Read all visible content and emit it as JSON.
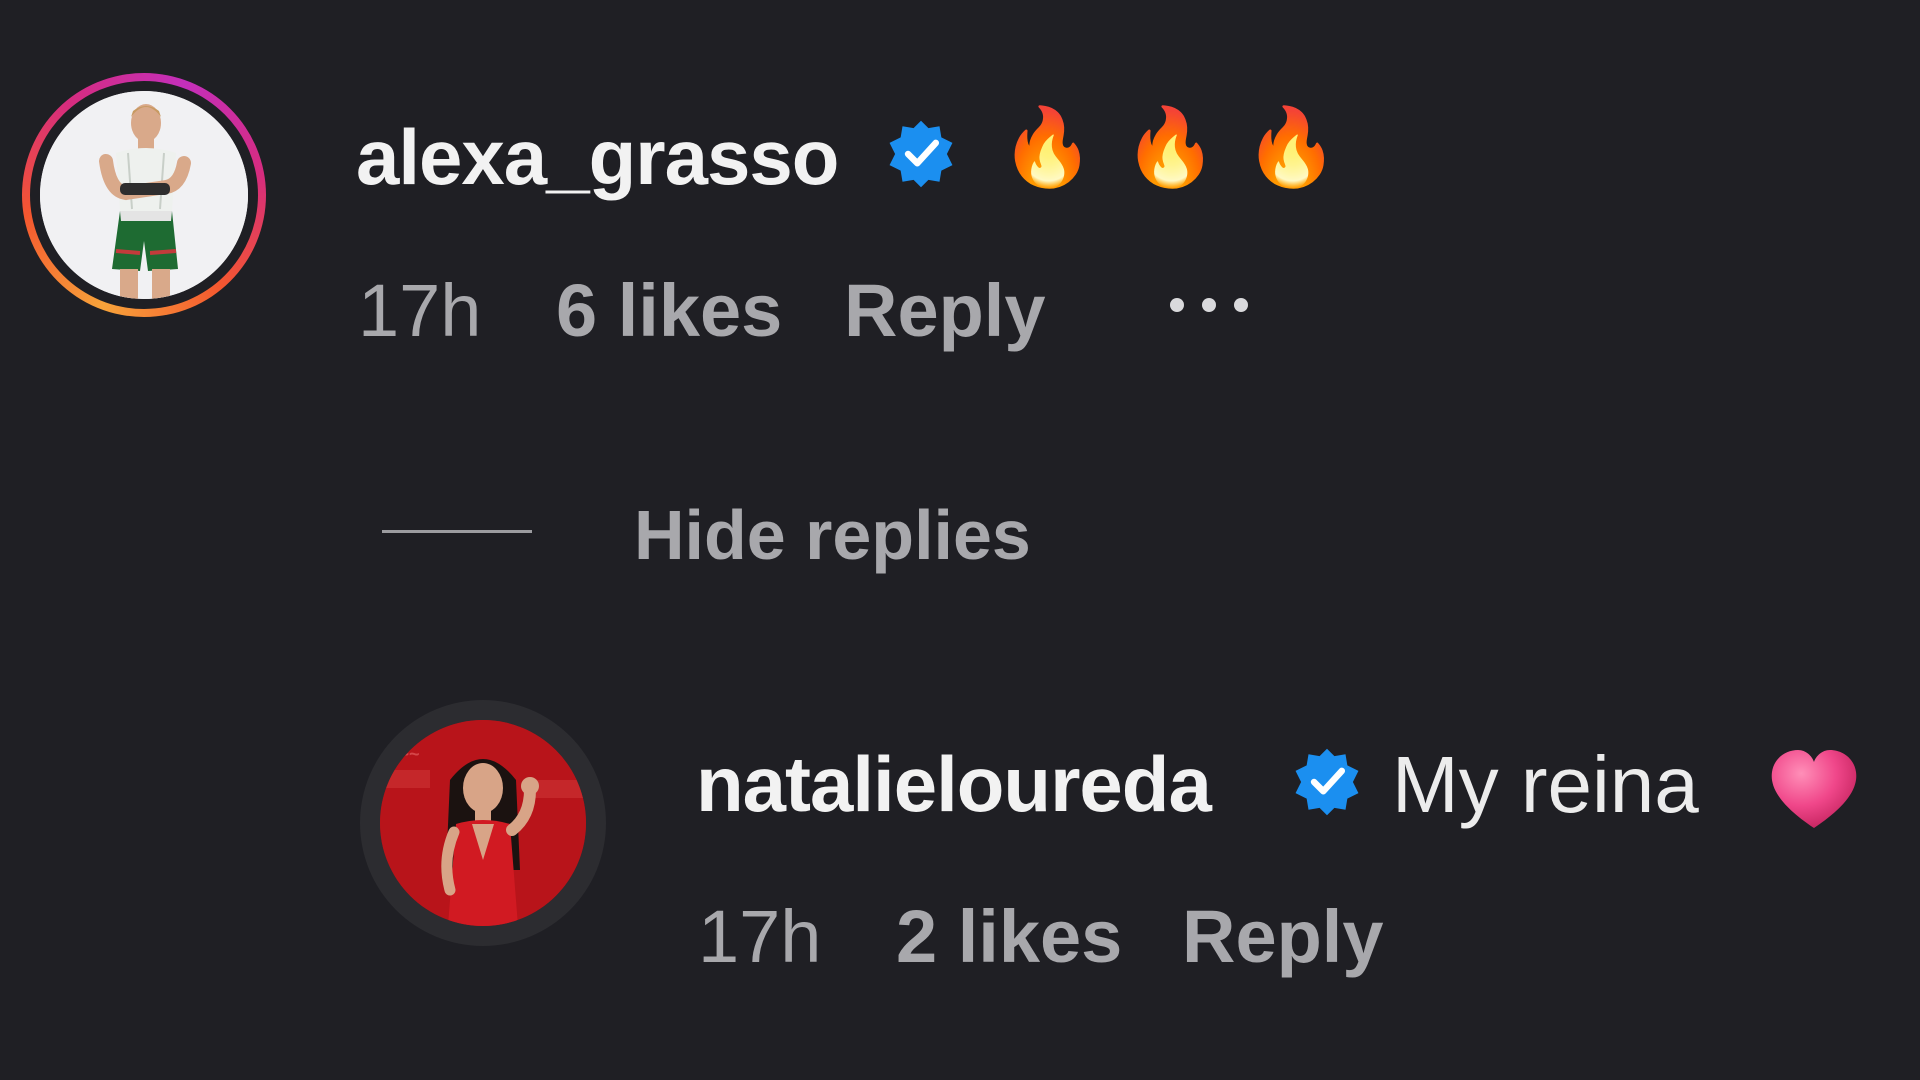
{
  "comments": [
    {
      "username": "alexa_grasso",
      "verified": true,
      "text_icons": [
        "fire-emoji",
        "fire-emoji",
        "fire-emoji"
      ],
      "fire": "🔥",
      "time": "17h",
      "likes": "6 likes",
      "reply": "Reply",
      "more": "•••",
      "avatar_ring": "story-gradient"
    }
  ],
  "thread": {
    "toggle_label": "Hide replies"
  },
  "replies": [
    {
      "username": "natalieloureda",
      "verified": true,
      "text": "My reina",
      "heart_icon": "pink-heart-emoji",
      "time": "17h",
      "likes": "2 likes",
      "reply": "Reply"
    }
  ],
  "colors": {
    "background": "#1f1f24",
    "verified_blue": "#1b8ff0",
    "meta_gray": "#a8a8ac",
    "heart_pink": "#f0478a"
  }
}
